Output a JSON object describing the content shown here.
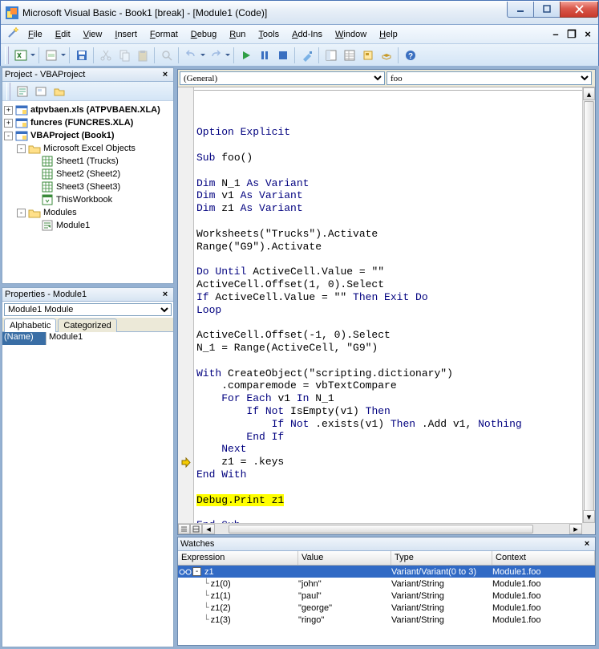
{
  "window": {
    "title": "Microsoft Visual Basic - Book1 [break] - [Module1 (Code)]"
  },
  "menu": {
    "items": [
      "File",
      "Edit",
      "View",
      "Insert",
      "Format",
      "Debug",
      "Run",
      "Tools",
      "Add-Ins",
      "Window",
      "Help"
    ]
  },
  "project_panel": {
    "title": "Project - VBAProject",
    "nodes": [
      {
        "depth": 0,
        "expander": "+",
        "icon": "vba",
        "label": "atpvbaen.xls (ATPVBAEN.XLA)",
        "bold": true
      },
      {
        "depth": 0,
        "expander": "+",
        "icon": "vba",
        "label": "funcres (FUNCRES.XLA)",
        "bold": true
      },
      {
        "depth": 0,
        "expander": "-",
        "icon": "vba",
        "label": "VBAProject (Book1)",
        "bold": true
      },
      {
        "depth": 1,
        "expander": "-",
        "icon": "folder",
        "label": "Microsoft Excel Objects"
      },
      {
        "depth": 2,
        "expander": "",
        "icon": "sheet",
        "label": "Sheet1 (Trucks)"
      },
      {
        "depth": 2,
        "expander": "",
        "icon": "sheet",
        "label": "Sheet2 (Sheet2)"
      },
      {
        "depth": 2,
        "expander": "",
        "icon": "sheet",
        "label": "Sheet3 (Sheet3)"
      },
      {
        "depth": 2,
        "expander": "",
        "icon": "wb",
        "label": "ThisWorkbook"
      },
      {
        "depth": 1,
        "expander": "-",
        "icon": "folder",
        "label": "Modules"
      },
      {
        "depth": 2,
        "expander": "",
        "icon": "module",
        "label": "Module1"
      }
    ]
  },
  "properties_panel": {
    "title": "Properties - Module1",
    "selector": "Module1 Module",
    "tabs": [
      "Alphabetic",
      "Categorized"
    ],
    "rows": [
      {
        "name": "(Name)",
        "value": "Module1"
      }
    ]
  },
  "code": {
    "object_dd": "(General)",
    "proc_dd": "foo",
    "lines": [
      {
        "t": "Option Explicit",
        "cls": "kw"
      },
      {
        "t": ""
      },
      {
        "segs": [
          {
            "t": "Sub ",
            "cls": "kw"
          },
          {
            "t": "foo()"
          }
        ]
      },
      {
        "t": ""
      },
      {
        "segs": [
          {
            "t": "Dim ",
            "cls": "kw"
          },
          {
            "t": "N_1 "
          },
          {
            "t": "As Variant",
            "cls": "kw"
          }
        ]
      },
      {
        "segs": [
          {
            "t": "Dim ",
            "cls": "kw"
          },
          {
            "t": "v1 "
          },
          {
            "t": "As Variant",
            "cls": "kw"
          }
        ]
      },
      {
        "segs": [
          {
            "t": "Dim ",
            "cls": "kw"
          },
          {
            "t": "z1 "
          },
          {
            "t": "As Variant",
            "cls": "kw"
          }
        ]
      },
      {
        "t": ""
      },
      {
        "t": "Worksheets(\"Trucks\").Activate"
      },
      {
        "t": "Range(\"G9\").Activate"
      },
      {
        "t": ""
      },
      {
        "segs": [
          {
            "t": "Do Until",
            "cls": "kw"
          },
          {
            "t": " ActiveCell.Value = \"\""
          }
        ]
      },
      {
        "t": "ActiveCell.Offset(1, 0).Select"
      },
      {
        "segs": [
          {
            "t": "If",
            "cls": "kw"
          },
          {
            "t": " ActiveCell.Value = \"\" "
          },
          {
            "t": "Then Exit Do",
            "cls": "kw"
          }
        ]
      },
      {
        "t": "Loop",
        "cls": "kw"
      },
      {
        "t": ""
      },
      {
        "t": "ActiveCell.Offset(-1, 0).Select"
      },
      {
        "t": "N_1 = Range(ActiveCell, \"G9\")"
      },
      {
        "t": ""
      },
      {
        "segs": [
          {
            "t": "With",
            "cls": "kw"
          },
          {
            "t": " CreateObject(\"scripting.dictionary\")"
          }
        ]
      },
      {
        "t": "    .comparemode = vbTextCompare"
      },
      {
        "segs": [
          {
            "t": "    "
          },
          {
            "t": "For Each",
            "cls": "kw"
          },
          {
            "t": " v1 "
          },
          {
            "t": "In",
            "cls": "kw"
          },
          {
            "t": " N_1"
          }
        ]
      },
      {
        "segs": [
          {
            "t": "        "
          },
          {
            "t": "If Not",
            "cls": "kw"
          },
          {
            "t": " IsEmpty(v1) "
          },
          {
            "t": "Then",
            "cls": "kw"
          }
        ]
      },
      {
        "segs": [
          {
            "t": "            "
          },
          {
            "t": "If Not",
            "cls": "kw"
          },
          {
            "t": " .exists(v1) "
          },
          {
            "t": "Then",
            "cls": "kw"
          },
          {
            "t": " .Add v1, "
          },
          {
            "t": "Nothing",
            "cls": "kw"
          }
        ]
      },
      {
        "segs": [
          {
            "t": "        "
          },
          {
            "t": "End If",
            "cls": "kw"
          }
        ]
      },
      {
        "segs": [
          {
            "t": "    "
          },
          {
            "t": "Next",
            "cls": "kw"
          }
        ]
      },
      {
        "t": "    z1 = .keys"
      },
      {
        "t": "End With",
        "cls": "kw"
      },
      {
        "t": ""
      },
      {
        "segs": [
          {
            "t": "Debug.Print z1",
            "cls": "hl"
          }
        ]
      },
      {
        "t": ""
      },
      {
        "t": "End Sub",
        "cls": "kw"
      }
    ],
    "breakpoint_line_index": 29
  },
  "watches": {
    "title": "Watches",
    "columns": [
      "Expression",
      "Value",
      "Type",
      "Context"
    ],
    "rows": [
      {
        "icon": "glasses",
        "exp": "-",
        "indent": 0,
        "expr": "z1",
        "value": "",
        "type": "Variant/Variant(0 to 3)",
        "ctx": "Module1.foo",
        "selected": true
      },
      {
        "indent": 1,
        "expr": "z1(0)",
        "value": "\"john\"",
        "type": "Variant/String",
        "ctx": "Module1.foo"
      },
      {
        "indent": 1,
        "expr": "z1(1)",
        "value": "\"paul\"",
        "type": "Variant/String",
        "ctx": "Module1.foo"
      },
      {
        "indent": 1,
        "expr": "z1(2)",
        "value": "\"george\"",
        "type": "Variant/String",
        "ctx": "Module1.foo"
      },
      {
        "indent": 1,
        "expr": "z1(3)",
        "value": "\"ringo\"",
        "type": "Variant/String",
        "ctx": "Module1.foo"
      }
    ]
  }
}
